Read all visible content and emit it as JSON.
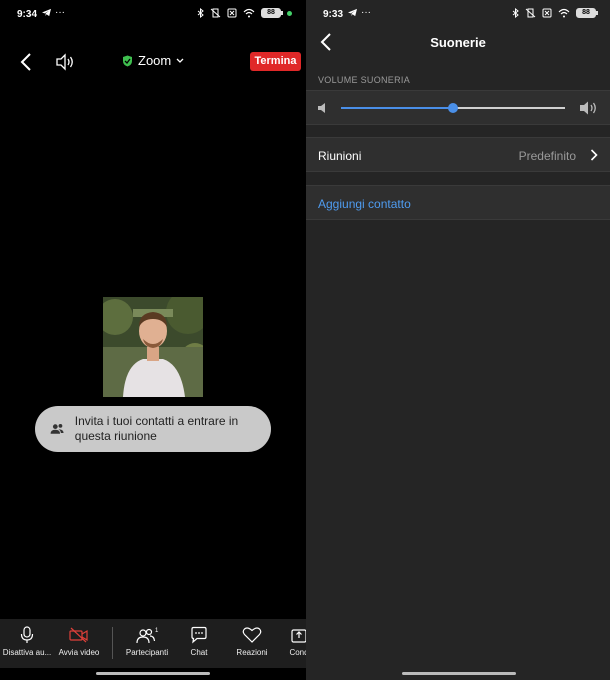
{
  "left": {
    "status": {
      "time": "9:34",
      "battery": "88"
    },
    "header": {
      "meeting_name": "Zoom",
      "end_label": "Termina"
    },
    "invite": {
      "text": "Invita i tuoi contatti a entrare in questa riunione"
    },
    "toolbar": {
      "items": [
        {
          "label": "Disattiva au...",
          "icon": "microphone-icon"
        },
        {
          "label": "Avvia video",
          "icon": "video-off-icon"
        },
        {
          "label": "Partecipanti",
          "icon": "participants-icon",
          "badge": "1"
        },
        {
          "label": "Chat",
          "icon": "chat-icon"
        },
        {
          "label": "Reazioni",
          "icon": "heart-icon"
        },
        {
          "label": "Cond",
          "icon": "share-icon"
        }
      ]
    }
  },
  "right": {
    "status": {
      "time": "9:33",
      "battery": "88"
    },
    "title": "Suonerie",
    "volume_label": "VOLUME SUONERIA",
    "volume_level": 0.5,
    "meetings_row": {
      "label": "Riunioni",
      "value": "Predefinito"
    },
    "add_contact": "Aggiungi contatto"
  },
  "colors": {
    "end_button": "#e02828",
    "accent": "#4a8fe8",
    "link": "#4f9cf0"
  }
}
